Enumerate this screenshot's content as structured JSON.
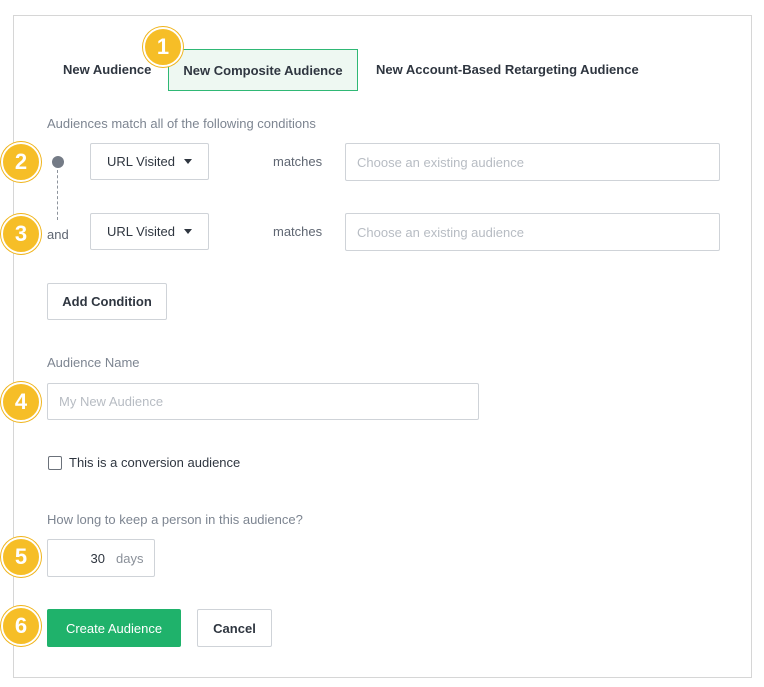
{
  "tabs": [
    {
      "label": "New Audience"
    },
    {
      "label": "New Composite Audience"
    },
    {
      "label": "New Account-Based Retargeting Audience"
    }
  ],
  "conditions": {
    "intro": "Audiences match all of the following conditions",
    "rows": [
      {
        "connector": "",
        "field": "URL Visited",
        "operator": "matches",
        "placeholder": "Choose an existing audience"
      },
      {
        "connector": "and",
        "field": "URL Visited",
        "operator": "matches",
        "placeholder": "Choose an existing audience"
      }
    ],
    "add_label": "Add Condition"
  },
  "audience_name": {
    "label": "Audience Name",
    "placeholder": "My New Audience"
  },
  "conversion": {
    "label": "This is a conversion audience",
    "checked": false
  },
  "duration": {
    "label": "How long to keep a person in this audience?",
    "value": "30",
    "unit": "days"
  },
  "actions": {
    "create_label": "Create Audience",
    "cancel_label": "Cancel"
  },
  "badges": [
    "1",
    "2",
    "3",
    "4",
    "5",
    "6"
  ],
  "colors": {
    "accent": "#1fb26b",
    "badge": "#f6be27",
    "active_tab_border": "#2fb875"
  }
}
